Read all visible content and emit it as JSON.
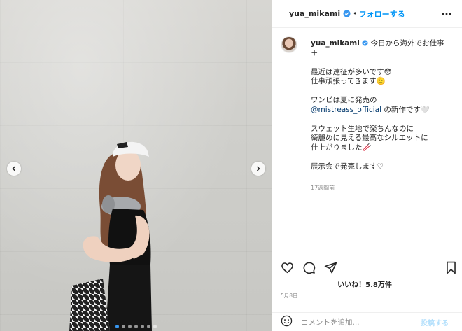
{
  "post": {
    "username": "yua_mikami",
    "separator": "•",
    "follow_label": "フォローする",
    "caption_first_line": "今日から海外でお仕事",
    "caption_rest": "＋\n\n最近は遠征が多いです😳\n仕事頑張ってきます🫡\n\nワンピは夏に発売の",
    "mention": "@mistreass_official",
    "caption_after_mention": " の新作です🤍\n\nスウェット生地で楽ちんなのに\n綺麗めに見える最高なシルエットに\n仕上がりました🥢\n\n展示会で発売します♡",
    "caption_time": "17週間前",
    "likes": "いいね！5.8万件",
    "date": "5月8日",
    "comment_placeholder": "コメントを追加...",
    "post_label": "投稿する"
  },
  "icons": {
    "verified": "verified-badge-icon",
    "more": "more-options-icon",
    "like": "heart-icon",
    "comment": "comment-icon",
    "share": "share-icon",
    "save": "bookmark-icon",
    "emoji": "emoji-icon",
    "prev": "chevron-left-icon",
    "next": "chevron-right-icon"
  },
  "carousel": {
    "slides": 7,
    "active_index": 0
  },
  "colors": {
    "accent": "#0095f6",
    "mention": "#00376b",
    "muted": "#8e8e8e"
  }
}
